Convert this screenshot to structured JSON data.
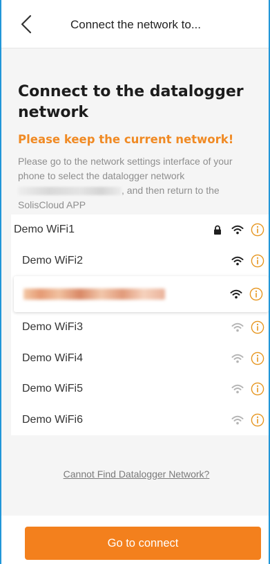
{
  "header": {
    "back_icon": "chevron-left-icon",
    "title": "Connect the network to..."
  },
  "intro": {
    "heading": "Connect to the datalogger network",
    "warning": "Please keep the current network!",
    "desc_before": "Please go to the network settings interface of your phone to select the datalogger network",
    "desc_after": ", and then return to the SolisCloud APP"
  },
  "networks": [
    {
      "name": "Demo WiFi1",
      "locked": true,
      "signal": "strong",
      "info_icon": "info-icon"
    },
    {
      "name": "Demo WiFi2",
      "locked": false,
      "signal": "strong",
      "info_icon": "info-icon"
    },
    {
      "name": "",
      "locked": false,
      "signal": "strong",
      "selected": true,
      "redacted": true,
      "info_icon": "info-icon"
    },
    {
      "name": "Demo WiFi3",
      "locked": false,
      "signal": "weak",
      "info_icon": "info-icon"
    },
    {
      "name": "Demo WiFi4",
      "locked": false,
      "signal": "weak",
      "info_icon": "info-icon"
    },
    {
      "name": "Demo WiFi5",
      "locked": false,
      "signal": "weak",
      "info_icon": "info-icon"
    },
    {
      "name": "Demo WiFi6",
      "locked": false,
      "signal": "weak",
      "info_icon": "info-icon"
    }
  ],
  "cannot_find_link": "Cannot Find Datalogger Network?",
  "connect_button": "Go to connect",
  "colors": {
    "accent": "#f3801d",
    "warning": "#f08a24",
    "wifi_strong": "#1f1f1f",
    "wifi_weak": "#b5b5b5",
    "info": "#e6951e"
  }
}
